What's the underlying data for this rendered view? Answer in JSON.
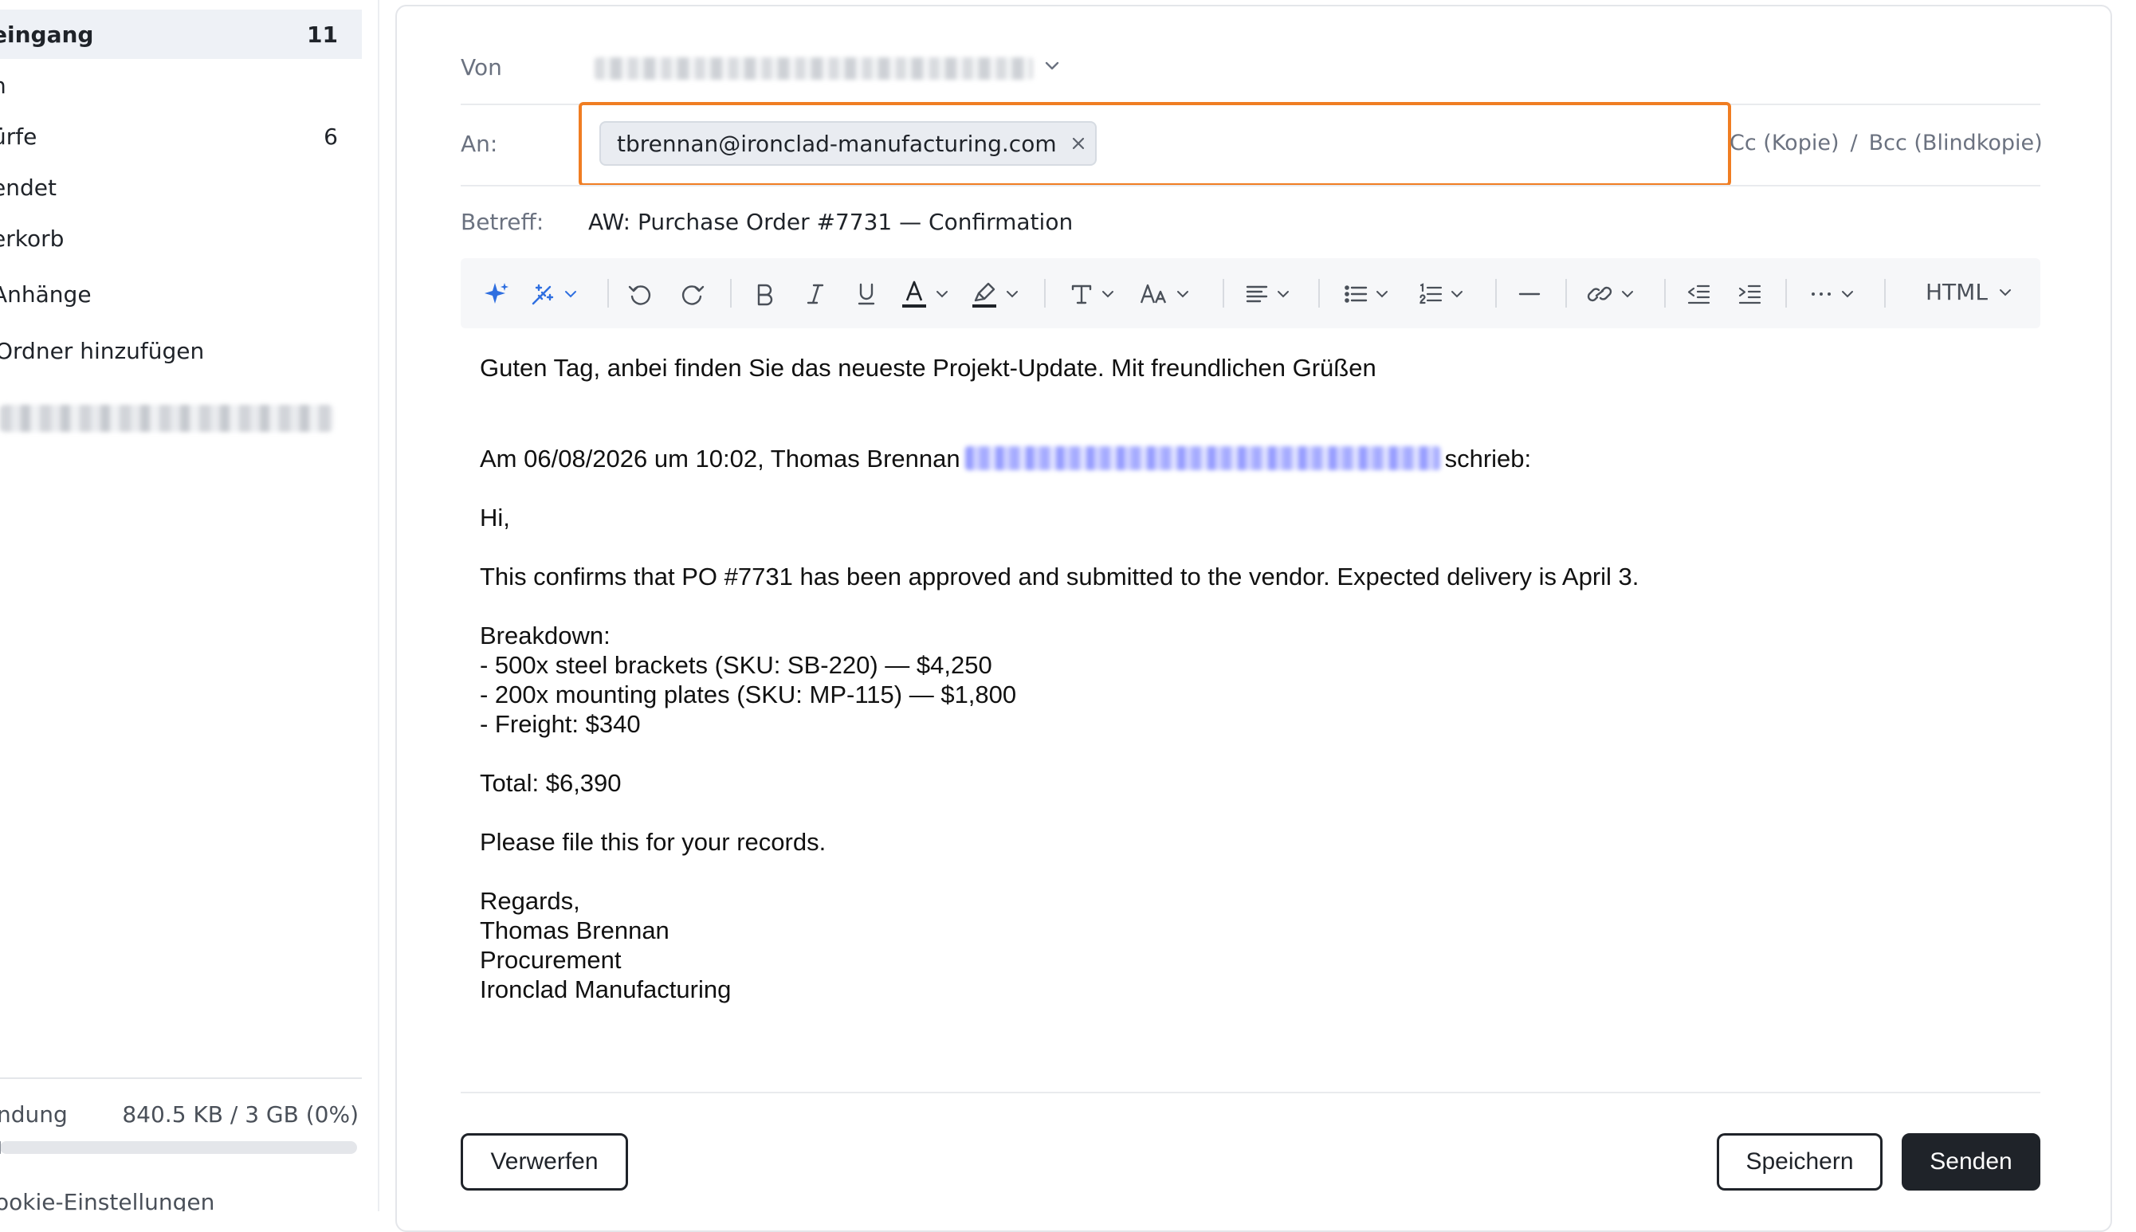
{
  "sidebar": {
    "folders": [
      {
        "label": "eingang",
        "count": "11",
        "active": true
      },
      {
        "label": "n",
        "count": ""
      },
      {
        "label": "ürfe",
        "count": "6"
      },
      {
        "label": "endet",
        "count": ""
      },
      {
        "label": "erkorb",
        "count": ""
      },
      {
        "label": "Anhänge",
        "count": ""
      }
    ],
    "add_folder": "Ordner hinzufügen",
    "storage_label": "ndung",
    "storage_value": "840.5 KB / 3 GB (0%)",
    "storage_fraction": 0.003,
    "cookie": "ookie-Einstellungen"
  },
  "compose": {
    "from_label": "Von",
    "to_label": "An:",
    "recipient": "tbrennan@ironclad-manufacturing.com",
    "cc_label": "Cc (Kopie)",
    "slash": "/",
    "bcc_label": "Bcc (Blindkopie)",
    "subject_label": "Betreff:",
    "subject": "AW: Purchase Order #7731 — Confirmation",
    "toolbar_html": "HTML"
  },
  "body": {
    "line1": "Guten Tag, anbei finden Sie das neueste Projekt-Update. Mit freundlichen Grüßen",
    "quote_prefix": "Am 06/08/2026 um 10:02, Thomas Brennan",
    "quote_suffix": "schrieb:",
    "hi": "Hi,",
    "confirm": "This confirms that PO #7731 has been approved and submitted to the vendor. Expected delivery is April 3.",
    "breakdown": "Breakdown:",
    "item1": "- 500x steel brackets (SKU: SB-220) — $4,250",
    "item2": "- 200x mounting plates (SKU: MP-115) — $1,800",
    "item3": "- Freight: $340",
    "total": "Total: $6,390",
    "file": "Please file this for your records.",
    "regards": "Regards,",
    "sig_name": "Thomas Brennan",
    "sig_dept": "Procurement",
    "sig_company": "Ironclad Manufacturing"
  },
  "actions": {
    "discard": "Verwerfen",
    "save": "Speichern",
    "send": "Senden"
  },
  "colors": {
    "accent_focus": "#f07d22",
    "primary_dark": "#1f2329",
    "muted": "#6b7280"
  }
}
